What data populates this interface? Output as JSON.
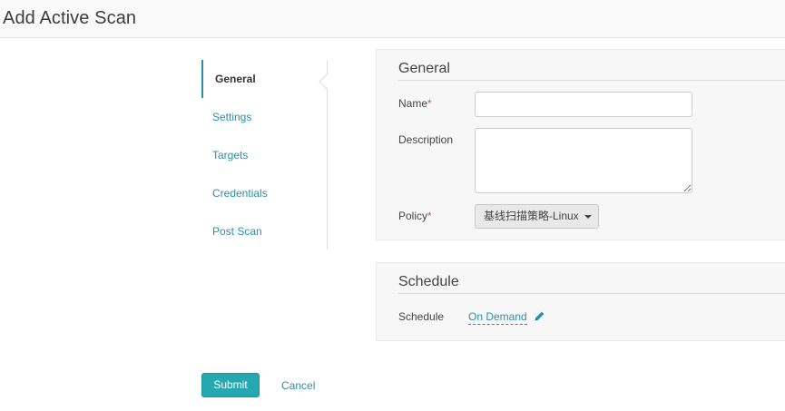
{
  "header": {
    "title": "Add Active Scan"
  },
  "nav": {
    "items": [
      {
        "label": "General",
        "active": true
      },
      {
        "label": "Settings",
        "active": false
      },
      {
        "label": "Targets",
        "active": false
      },
      {
        "label": "Credentials",
        "active": false
      },
      {
        "label": "Post Scan",
        "active": false
      }
    ]
  },
  "general": {
    "title": "General",
    "name_label": "Name",
    "name_value": "",
    "description_label": "Description",
    "description_value": "",
    "policy_label": "Policy",
    "policy_value": "基线扫描策略-Linux",
    "required_mark": "*"
  },
  "schedule": {
    "title": "Schedule",
    "label": "Schedule",
    "value": "On Demand"
  },
  "actions": {
    "submit_label": "Submit",
    "cancel_label": "Cancel"
  },
  "icons": {
    "edit": "pencil-icon",
    "dropdown": "caret-down-icon"
  },
  "colors": {
    "accent": "#2a8fa6",
    "submit_bg": "#26a8b1",
    "required": "#d9534f"
  }
}
